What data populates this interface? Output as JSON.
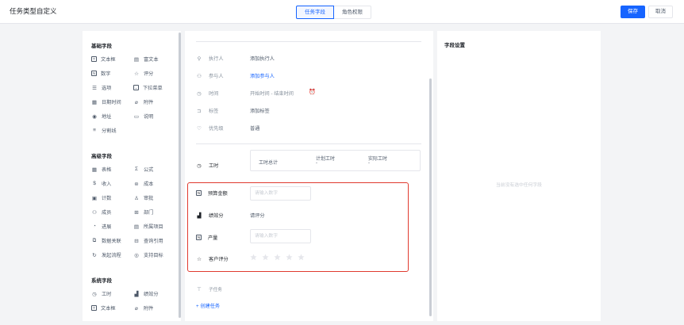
{
  "header": {
    "title": "任务类型自定义",
    "tabs": [
      "任务字段",
      "角色权限"
    ],
    "save": "保存",
    "cancel": "取消"
  },
  "palette": {
    "basic_title": "基础字段",
    "basic": [
      [
        "文本框",
        "富文本"
      ],
      [
        "数字",
        "评分"
      ],
      [
        "选项",
        "下拉菜单"
      ],
      [
        "日期时间",
        "附件"
      ],
      [
        "地址",
        "说明"
      ],
      [
        "分割线",
        ""
      ]
    ],
    "advanced_title": "高级字段",
    "advanced": [
      [
        "表格",
        "公式"
      ],
      [
        "收入",
        "成本"
      ],
      [
        "计数",
        "审批"
      ],
      [
        "成员",
        "部门"
      ],
      [
        "进展",
        "所属项目"
      ],
      [
        "数据关联",
        "查询引用"
      ],
      [
        "发起流程",
        "支持目标"
      ]
    ],
    "system_title": "系统字段",
    "system": [
      [
        "工时",
        "绩效分"
      ],
      [
        "文本框",
        "附件"
      ]
    ]
  },
  "form": {
    "executor_label": "执行人",
    "executor_value": "添加执行人",
    "participant_label": "参与人",
    "participant_value": "添加参与人",
    "time_label": "时间",
    "time_value": "开始时间 - 结束时间",
    "tag_label": "标签",
    "tag_value": "添加标签",
    "priority_label": "优先级",
    "priority_value": "普通",
    "worktime_label": "工时",
    "worktime_total": "工时总计",
    "worktime_planned": "计划工时",
    "worktime_planned_value": "-",
    "worktime_actual": "实际工时",
    "worktime_actual_value": "-",
    "budget_label": "预算金额",
    "budget_placeholder": "请输入数字",
    "perf_label": "绩效分",
    "perf_value": "请评分",
    "output_label": "产量",
    "output_placeholder": "请输入数字",
    "rating_label": "客户评分",
    "rating_stars": 5,
    "subtask_label": "子任务",
    "create_task": "+ 创建任务"
  },
  "settings": {
    "title": "字段设置",
    "empty": "当前没有选中任何字段"
  },
  "colors": {
    "accent": "#1664ff",
    "highlight": "#e03a2f"
  }
}
